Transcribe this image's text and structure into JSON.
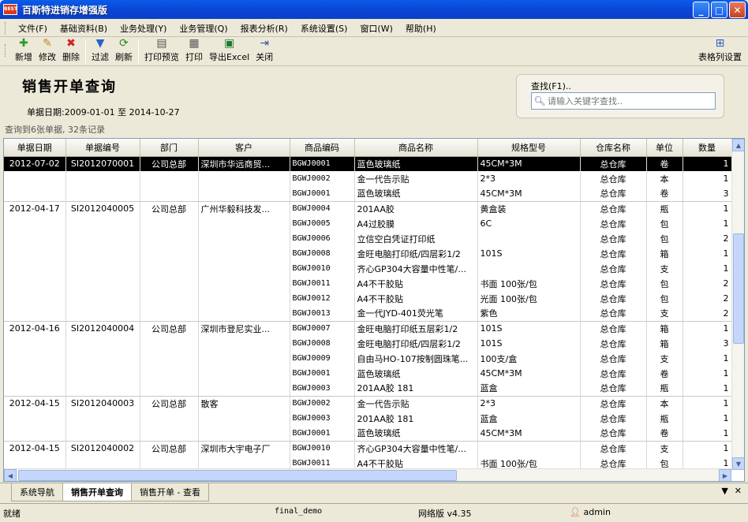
{
  "window": {
    "logo_text": "BEST",
    "title": "百斯特进销存增强版",
    "minimize": "_",
    "maximize": "□",
    "close": "✕"
  },
  "menu": [
    "文件(F)",
    "基础资料(B)",
    "业务处理(Y)",
    "业务管理(Q)",
    "报表分析(R)",
    "系统设置(S)",
    "窗口(W)",
    "帮助(H)"
  ],
  "toolbar": {
    "new": "新增",
    "edit": "修改",
    "delete": "删除",
    "filter": "过滤",
    "refresh": "刷新",
    "print_preview": "打印预览",
    "print": "打印",
    "export_excel": "导出Excel",
    "close": "关闭",
    "column_settings": "表格列设置"
  },
  "header": {
    "title": "销售开单查询",
    "date_label": "单据日期:",
    "date_from": "2009-01-01",
    "date_to_word": "至",
    "date_to": "2014-10-27",
    "search_label": "查找(F1)..",
    "search_placeholder": "请输入关键字查找.."
  },
  "summary": "查询到6张单据, 32条记录",
  "columns": [
    "单据日期",
    "单据编号",
    "部门",
    "客户",
    "商品编码",
    "商品名称",
    "规格型号",
    "仓库名称",
    "单位",
    "数量"
  ],
  "rows": [
    {
      "date": "2012-07-02",
      "no": "SI2012070001",
      "dept": "公司总部",
      "cust": "深圳市华远商贸...",
      "code": "BGWJ0001",
      "name": "蓝色玻璃纸",
      "spec": "45CM*3M",
      "wh": "总仓库",
      "unit": "卷",
      "qty": "1",
      "sel": true,
      "end": false
    },
    {
      "date": "",
      "no": "",
      "dept": "",
      "cust": "",
      "code": "BGWJ0002",
      "name": "金一代告示贴",
      "spec": "2*3",
      "wh": "总仓库",
      "unit": "本",
      "qty": "1",
      "sel": false,
      "end": false
    },
    {
      "date": "",
      "no": "",
      "dept": "",
      "cust": "",
      "code": "BGWJ0001",
      "name": "蓝色玻璃纸",
      "spec": "45CM*3M",
      "wh": "总仓库",
      "unit": "卷",
      "qty": "3",
      "sel": false,
      "end": true
    },
    {
      "date": "2012-04-17",
      "no": "SI2012040005",
      "dept": "公司总部",
      "cust": "广州华毅科技发...",
      "code": "BGWJ0004",
      "name": "201AA胶",
      "spec": "黄盒装",
      "wh": "总仓库",
      "unit": "瓶",
      "qty": "1",
      "sel": false,
      "end": false
    },
    {
      "date": "",
      "no": "",
      "dept": "",
      "cust": "",
      "code": "BGWJ0005",
      "name": "A4过胶膜",
      "spec": "6C",
      "wh": "总仓库",
      "unit": "包",
      "qty": "1",
      "sel": false,
      "end": false
    },
    {
      "date": "",
      "no": "",
      "dept": "",
      "cust": "",
      "code": "BGWJ0006",
      "name": "立信空白凭证打印纸",
      "spec": "",
      "wh": "总仓库",
      "unit": "包",
      "qty": "2",
      "sel": false,
      "end": false
    },
    {
      "date": "",
      "no": "",
      "dept": "",
      "cust": "",
      "code": "BGWJ0008",
      "name": "金旺电脑打印纸/四层彩1/2",
      "spec": "101S",
      "wh": "总仓库",
      "unit": "箱",
      "qty": "1",
      "sel": false,
      "end": false
    },
    {
      "date": "",
      "no": "",
      "dept": "",
      "cust": "",
      "code": "BGWJ0010",
      "name": "齐心GP304大容量中性笔/...",
      "spec": "",
      "wh": "总仓库",
      "unit": "支",
      "qty": "1",
      "sel": false,
      "end": false
    },
    {
      "date": "",
      "no": "",
      "dept": "",
      "cust": "",
      "code": "BGWJ0011",
      "name": "A4不干胶贴",
      "spec": "书面 100张/包",
      "wh": "总仓库",
      "unit": "包",
      "qty": "2",
      "sel": false,
      "end": false
    },
    {
      "date": "",
      "no": "",
      "dept": "",
      "cust": "",
      "code": "BGWJ0012",
      "name": "A4不干胶贴",
      "spec": "光面 100张/包",
      "wh": "总仓库",
      "unit": "包",
      "qty": "2",
      "sel": false,
      "end": false
    },
    {
      "date": "",
      "no": "",
      "dept": "",
      "cust": "",
      "code": "BGWJ0013",
      "name": "金一代JYD-401荧光笔",
      "spec": "紫色",
      "wh": "总仓库",
      "unit": "支",
      "qty": "2",
      "sel": false,
      "end": true
    },
    {
      "date": "2012-04-16",
      "no": "SI2012040004",
      "dept": "公司总部",
      "cust": "深圳市登尼实业...",
      "code": "BGWJ0007",
      "name": "金旺电脑打印纸五层彩1/2",
      "spec": "101S",
      "wh": "总仓库",
      "unit": "箱",
      "qty": "1",
      "sel": false,
      "end": false
    },
    {
      "date": "",
      "no": "",
      "dept": "",
      "cust": "",
      "code": "BGWJ0008",
      "name": "金旺电脑打印纸/四层彩1/2",
      "spec": "101S",
      "wh": "总仓库",
      "unit": "箱",
      "qty": "3",
      "sel": false,
      "end": false
    },
    {
      "date": "",
      "no": "",
      "dept": "",
      "cust": "",
      "code": "BGWJ0009",
      "name": "自由马HO-107按制圆珠笔...",
      "spec": "100支/盒",
      "wh": "总仓库",
      "unit": "支",
      "qty": "1",
      "sel": false,
      "end": false
    },
    {
      "date": "",
      "no": "",
      "dept": "",
      "cust": "",
      "code": "BGWJ0001",
      "name": "蓝色玻璃纸",
      "spec": "45CM*3M",
      "wh": "总仓库",
      "unit": "卷",
      "qty": "1",
      "sel": false,
      "end": false
    },
    {
      "date": "",
      "no": "",
      "dept": "",
      "cust": "",
      "code": "BGWJ0003",
      "name": "201AA胶 181",
      "spec": "蓝盒",
      "wh": "总仓库",
      "unit": "瓶",
      "qty": "1",
      "sel": false,
      "end": true
    },
    {
      "date": "2012-04-15",
      "no": "SI2012040003",
      "dept": "公司总部",
      "cust": "散客",
      "code": "BGWJ0002",
      "name": "金一代告示贴",
      "spec": "2*3",
      "wh": "总仓库",
      "unit": "本",
      "qty": "1",
      "sel": false,
      "end": false
    },
    {
      "date": "",
      "no": "",
      "dept": "",
      "cust": "",
      "code": "BGWJ0003",
      "name": "201AA胶 181",
      "spec": "蓝盒",
      "wh": "总仓库",
      "unit": "瓶",
      "qty": "1",
      "sel": false,
      "end": false
    },
    {
      "date": "",
      "no": "",
      "dept": "",
      "cust": "",
      "code": "BGWJ0001",
      "name": "蓝色玻璃纸",
      "spec": "45CM*3M",
      "wh": "总仓库",
      "unit": "卷",
      "qty": "1",
      "sel": false,
      "end": true
    },
    {
      "date": "2012-04-15",
      "no": "SI2012040002",
      "dept": "公司总部",
      "cust": "深圳市大宇电子厂",
      "code": "BGWJ0010",
      "name": "齐心GP304大容量中性笔/...",
      "spec": "",
      "wh": "总仓库",
      "unit": "支",
      "qty": "1",
      "sel": false,
      "end": false
    },
    {
      "date": "",
      "no": "",
      "dept": "",
      "cust": "",
      "code": "BGWJ0011",
      "name": "A4不干胶贴",
      "spec": "书面 100张/包",
      "wh": "总仓库",
      "unit": "包",
      "qty": "1",
      "sel": false,
      "end": false
    }
  ],
  "tabs": [
    "系统导航",
    "销售开单查询",
    "销售开单 - 查看"
  ],
  "tab_controls": {
    "dropdown": "▼",
    "close": "✕"
  },
  "status": {
    "state": "就绪",
    "db": "final_demo",
    "version": "网络版 v4.35",
    "user": "admin"
  },
  "colors": {
    "title_bar": "#0b46d6",
    "selected_row": "#000000",
    "panel": "#ece9d8"
  }
}
